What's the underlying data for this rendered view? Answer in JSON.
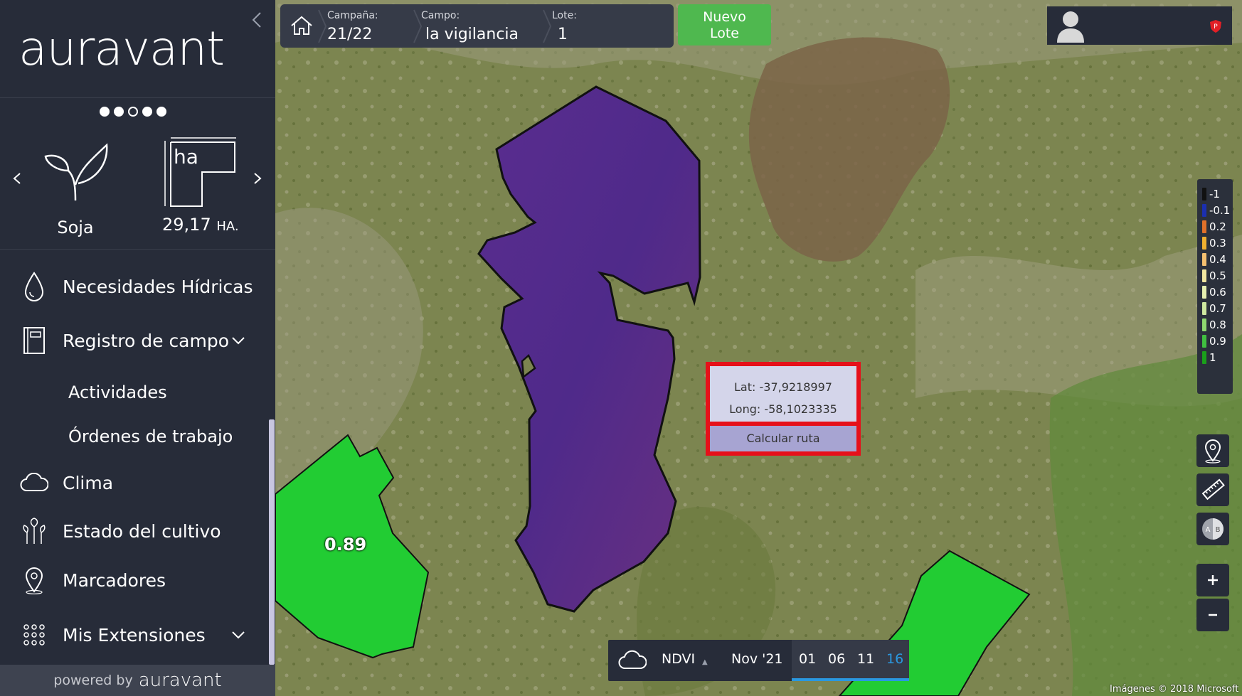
{
  "sidebar": {
    "logo": "auravant",
    "crop": "Soja",
    "area_unit_icon": "ha",
    "area_value": "29,17",
    "area_unit": "HA.",
    "menu": {
      "water": "Necesidades Hídricas",
      "field_log": "Registro de campo",
      "activities": "Actividades",
      "work_orders": "Órdenes de trabajo",
      "weather": "Clima",
      "crop_status": "Estado del cultivo",
      "markers": "Marcadores",
      "extensions": "Mis Extensiones"
    },
    "powered_by": "powered by",
    "powered_brand": "auravant"
  },
  "topbar": {
    "campaign_caption": "Campaña:",
    "campaign_value": "21/22",
    "field_caption": "Campo:",
    "field_value": "la vigilancia",
    "lot_caption": "Lote:",
    "lot_value": "1",
    "new_lot_line1": "Nuevo",
    "new_lot_line2": "Lote"
  },
  "legend": [
    {
      "label": "-1",
      "color": "#111111"
    },
    {
      "label": "-0.1",
      "color": "#1b2fb0"
    },
    {
      "label": "0.2",
      "color": "#e0702a"
    },
    {
      "label": "0.3",
      "color": "#f0b030"
    },
    {
      "label": "0.4",
      "color": "#f5c070"
    },
    {
      "label": "0.5",
      "color": "#f2e6a0"
    },
    {
      "label": "0.6",
      "color": "#e6efb0"
    },
    {
      "label": "0.7",
      "color": "#cfe8a0"
    },
    {
      "label": "0.8",
      "color": "#8fd870"
    },
    {
      "label": "0.9",
      "color": "#40c040"
    },
    {
      "label": "1",
      "color": "#1aa01a"
    }
  ],
  "popup": {
    "lat": "Lat: -37,9218997",
    "long": "Long: -58,1023335",
    "route_button": "Calcular ruta"
  },
  "bottombar": {
    "index": "NDVI",
    "month": "Nov '21",
    "days": [
      "01",
      "06",
      "11",
      "16"
    ],
    "active_day": "16"
  },
  "map": {
    "ndvi_value": "0.89",
    "attribution": "Imágenes © 2018 Microsoft"
  },
  "colors": {
    "sidebar_bg": "#272c39",
    "accent_green": "#4fb84f",
    "lot_purple": "#5b2d8e",
    "field_green": "#22cc33",
    "popup_border": "#e6101a",
    "active_day": "#2a98e0"
  }
}
